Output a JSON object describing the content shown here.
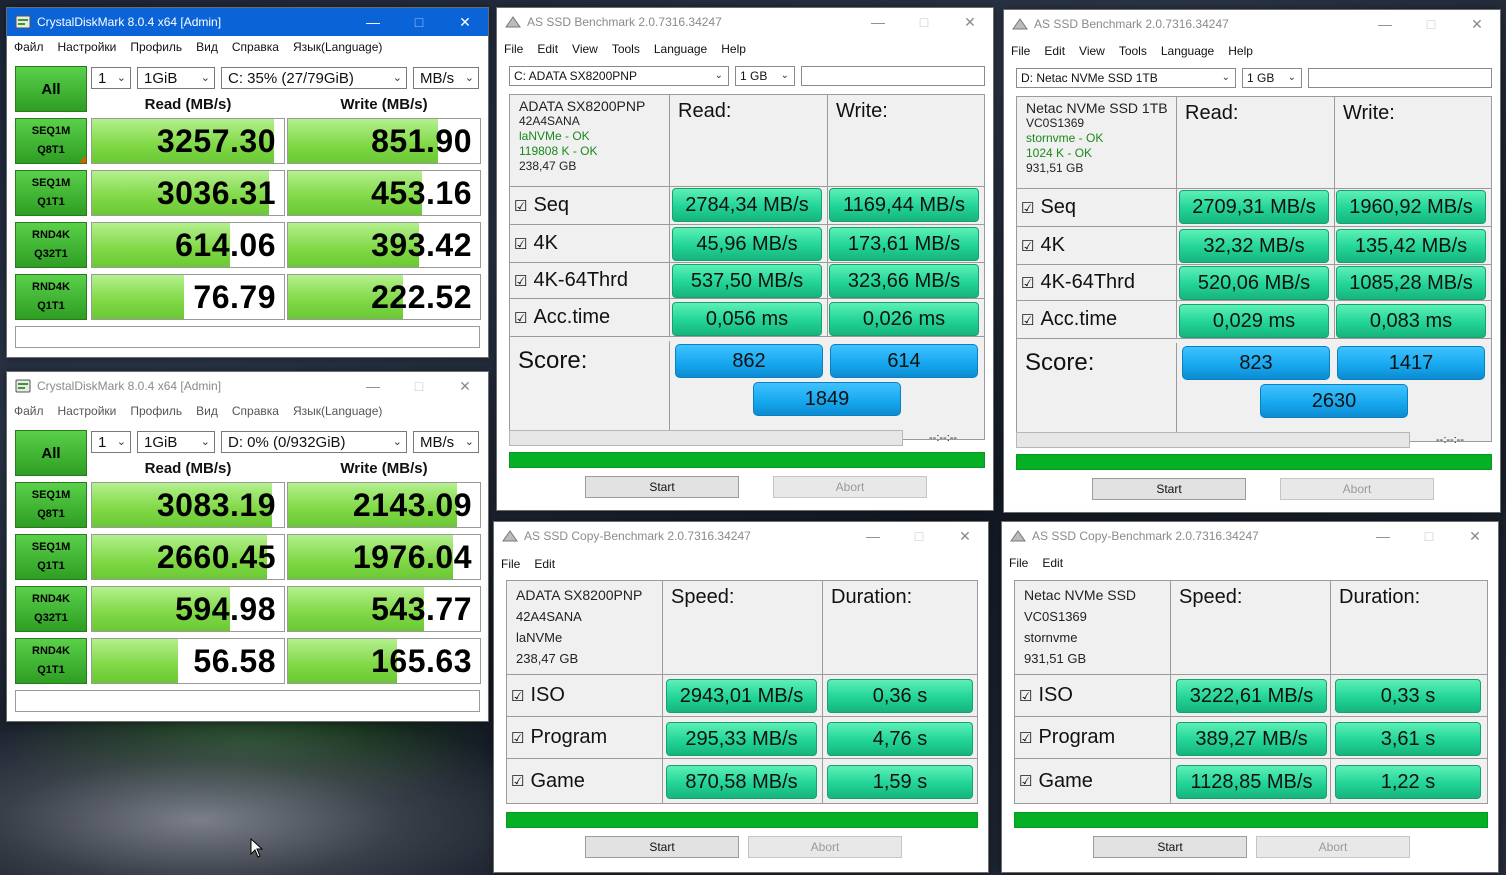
{
  "cdm1": {
    "title": "CrystalDiskMark 8.0.4 x64 [Admin]",
    "menu": [
      "Файл",
      "Настройки",
      "Профиль",
      "Вид",
      "Справка",
      "Язык(Language)"
    ],
    "all_label": "All",
    "count": "1",
    "size": "1GiB",
    "drive": "C: 35% (27/79GiB)",
    "unit": "MB/s",
    "read_header": "Read (MB/s)",
    "write_header": "Write (MB/s)",
    "rows": [
      {
        "l1": "SEQ1M",
        "l2": "Q8T1",
        "read": "3257.30",
        "write": "851.90",
        "read_fill": 0.95,
        "write_fill": 0.78
      },
      {
        "l1": "SEQ1M",
        "l2": "Q1T1",
        "read": "3036.31",
        "write": "453.16",
        "read_fill": 0.92,
        "write_fill": 0.7
      },
      {
        "l1": "RND4K",
        "l2": "Q32T1",
        "read": "614.06",
        "write": "393.42",
        "read_fill": 0.72,
        "write_fill": 0.68
      },
      {
        "l1": "RND4K",
        "l2": "Q1T1",
        "read": "76.79",
        "write": "222.52",
        "read_fill": 0.48,
        "write_fill": 0.6
      }
    ]
  },
  "cdm2": {
    "title": "CrystalDiskMark 8.0.4 x64 [Admin]",
    "menu": [
      "Файл",
      "Настройки",
      "Профиль",
      "Вид",
      "Справка",
      "Язык(Language)"
    ],
    "all_label": "All",
    "count": "1",
    "size": "1GiB",
    "drive": "D: 0% (0/932GiB)",
    "unit": "MB/s",
    "read_header": "Read (MB/s)",
    "write_header": "Write (MB/s)",
    "rows": [
      {
        "l1": "SEQ1M",
        "l2": "Q8T1",
        "read": "3083.19",
        "write": "2143.09",
        "read_fill": 0.94,
        "write_fill": 0.88
      },
      {
        "l1": "SEQ1M",
        "l2": "Q1T1",
        "read": "2660.45",
        "write": "1976.04",
        "read_fill": 0.91,
        "write_fill": 0.86
      },
      {
        "l1": "RND4K",
        "l2": "Q32T1",
        "read": "594.98",
        "write": "543.77",
        "read_fill": 0.72,
        "write_fill": 0.71
      },
      {
        "l1": "RND4K",
        "l2": "Q1T1",
        "read": "56.58",
        "write": "165.63",
        "read_fill": 0.45,
        "write_fill": 0.57
      }
    ]
  },
  "asbench": [
    {
      "title": "AS SSD Benchmark 2.0.7316.34247",
      "menu": [
        "File",
        "Edit",
        "View",
        "Tools",
        "Language",
        "Help"
      ],
      "drive_select": "C: ADATA SX8200PNP",
      "size_select": "1 GB",
      "info": [
        "ADATA SX8200PNP",
        "42A4SANA",
        "laNVMe - OK",
        "119808 K - OK",
        "238,47 GB"
      ],
      "read_header": "Read:",
      "write_header": "Write:",
      "rows": [
        {
          "label": "Seq",
          "read": "2784,34 MB/s",
          "write": "1169,44 MB/s"
        },
        {
          "label": "4K",
          "read": "45,96 MB/s",
          "write": "173,61 MB/s"
        },
        {
          "label": "4K-64Thrd",
          "read": "537,50 MB/s",
          "write": "323,66 MB/s"
        },
        {
          "label": "Acc.time",
          "read": "0,056 ms",
          "write": "0,026 ms"
        }
      ],
      "score_label": "Score:",
      "score_read": "862",
      "score_write": "614",
      "score_total": "1849",
      "timer": "--:--:--",
      "progress": 1.0,
      "start": "Start",
      "abort": "Abort"
    },
    {
      "title": "AS SSD Benchmark 2.0.7316.34247",
      "menu": [
        "File",
        "Edit",
        "View",
        "Tools",
        "Language",
        "Help"
      ],
      "drive_select": "D: Netac NVMe SSD 1TB",
      "size_select": "1 GB",
      "info": [
        "Netac NVMe SSD 1TB",
        "VC0S1369",
        "stornvme - OK",
        "1024 K - OK",
        "931,51 GB"
      ],
      "read_header": "Read:",
      "write_header": "Write:",
      "rows": [
        {
          "label": "Seq",
          "read": "2709,31 MB/s",
          "write": "1960,92 MB/s"
        },
        {
          "label": "4K",
          "read": "32,32 MB/s",
          "write": "135,42 MB/s"
        },
        {
          "label": "4K-64Thrd",
          "read": "520,06 MB/s",
          "write": "1085,28 MB/s"
        },
        {
          "label": "Acc.time",
          "read": "0,029 ms",
          "write": "0,083 ms"
        }
      ],
      "score_label": "Score:",
      "score_read": "823",
      "score_write": "1417",
      "score_total": "2630",
      "timer": "--:--:--",
      "progress": 1.0,
      "start": "Start",
      "abort": "Abort"
    }
  ],
  "ascopy": [
    {
      "title": "AS SSD Copy-Benchmark 2.0.7316.34247",
      "menu": [
        "File",
        "Edit"
      ],
      "info": [
        "ADATA SX8200PNP",
        "42A4SANA",
        "laNVMe",
        "238,47 GB"
      ],
      "speed_header": "Speed:",
      "duration_header": "Duration:",
      "rows": [
        {
          "label": "ISO",
          "speed": "2943,01 MB/s",
          "duration": "0,36 s"
        },
        {
          "label": "Program",
          "speed": "295,33 MB/s",
          "duration": "4,76 s"
        },
        {
          "label": "Game",
          "speed": "870,58 MB/s",
          "duration": "1,59 s"
        }
      ],
      "progress": 1.0,
      "start": "Start",
      "abort": "Abort"
    },
    {
      "title": "AS SSD Copy-Benchmark 2.0.7316.34247",
      "menu": [
        "File",
        "Edit"
      ],
      "info": [
        "Netac NVMe SSD",
        "VC0S1369",
        "stornvme",
        "931,51 GB"
      ],
      "speed_header": "Speed:",
      "duration_header": "Duration:",
      "rows": [
        {
          "label": "ISO",
          "speed": "3222,61 MB/s",
          "duration": "0,33 s"
        },
        {
          "label": "Program",
          "speed": "389,27 MB/s",
          "duration": "3,61 s"
        },
        {
          "label": "Game",
          "speed": "1128,85 MB/s",
          "duration": "1,22 s"
        }
      ],
      "progress": 1.0,
      "start": "Start",
      "abort": "Abort"
    }
  ]
}
